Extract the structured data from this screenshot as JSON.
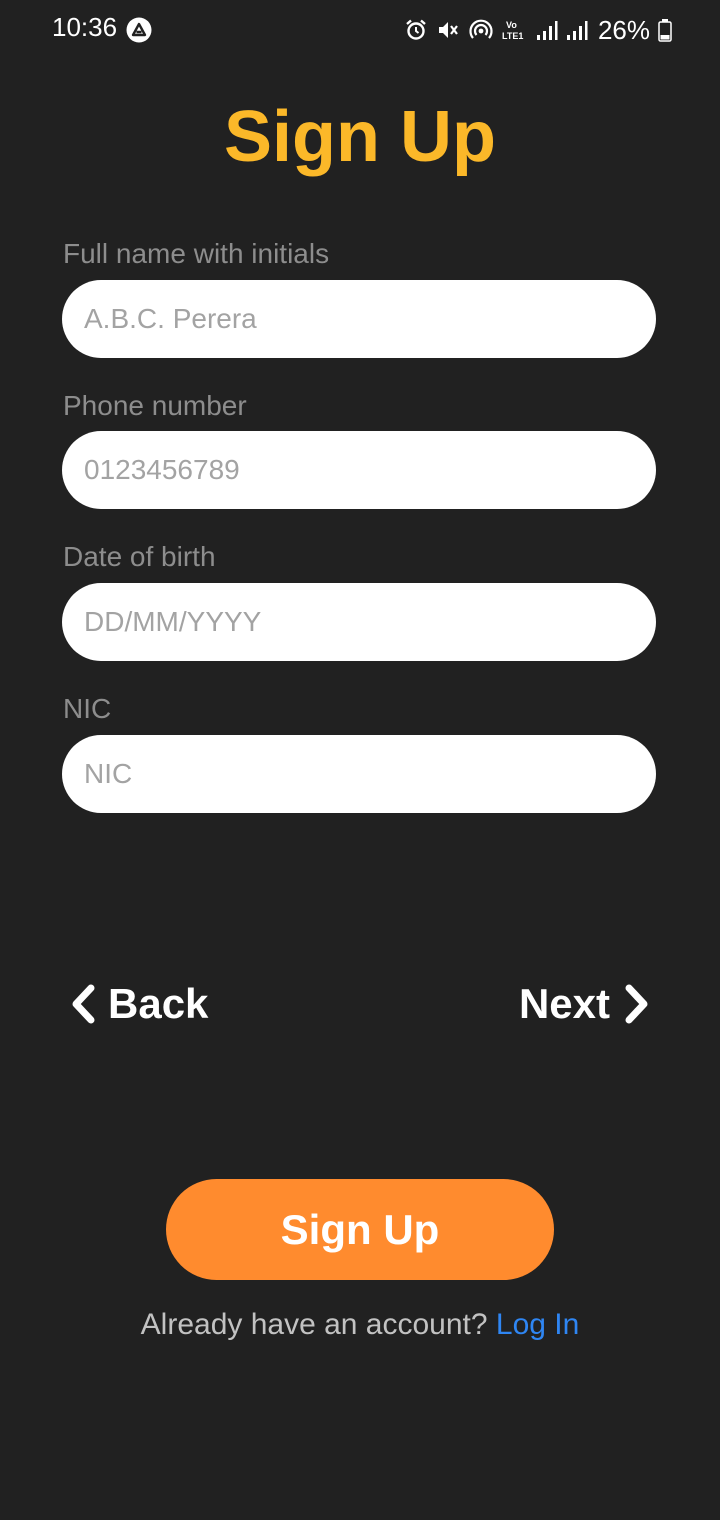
{
  "status_bar": {
    "time": "10:36",
    "battery": "26%",
    "icons": [
      "alarm-icon",
      "mute-icon",
      "hotspot-icon",
      "volte-icon",
      "signal-icon",
      "signal-icon",
      "battery-icon"
    ]
  },
  "title": "Sign Up",
  "fields": [
    {
      "label": "Full name with initials",
      "placeholder": "A.B.C. Perera"
    },
    {
      "label": "Phone number",
      "placeholder": "0123456789"
    },
    {
      "label": "Date of birth",
      "placeholder": "DD/MM/YYYY"
    },
    {
      "label": "NIC",
      "placeholder": "NIC"
    }
  ],
  "nav": {
    "back_label": "Back",
    "next_label": "Next"
  },
  "signup_button": "Sign Up",
  "login": {
    "prompt": "Already have an account?",
    "link": "Log In"
  },
  "colors": {
    "background": "#212121",
    "title": "#FBB829",
    "button": "#FF8B2E",
    "link": "#2F86F3",
    "label": "#8d8d8d"
  }
}
